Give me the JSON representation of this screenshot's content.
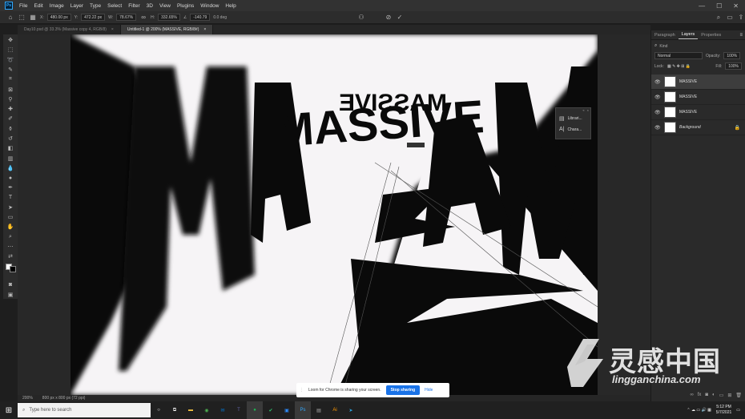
{
  "menubar": {
    "app_icon": "Ps",
    "items": [
      "File",
      "Edit",
      "Image",
      "Layer",
      "Type",
      "Select",
      "Filter",
      "3D",
      "View",
      "Plugins",
      "Window",
      "Help"
    ],
    "window_controls": [
      "—",
      "☐",
      "✕"
    ]
  },
  "options": {
    "x_label": "X:",
    "x_value": "480.00 px",
    "y_label": "Y:",
    "y_value": "472.22 px",
    "w_label": "W:",
    "w_value": "78.67%",
    "h_label": "H:",
    "h_value": "332.65%",
    "angle_label": "∠",
    "angle_value": "-140.79",
    "warp_label": "0.0 deg"
  },
  "tabs": [
    {
      "label": "Day10.psd @ 33.3% (Massive copy 4, RGB/8)",
      "close": "×",
      "active": false
    },
    {
      "label": "Untitled-1 @ 200% (MASSIVE, RGB/8#)",
      "close": "×",
      "active": true
    }
  ],
  "artwork": {
    "text": "MASSIVE"
  },
  "float_panel": {
    "items": [
      "Librari...",
      "Chara..."
    ]
  },
  "panel": {
    "tabs": [
      "Paragraph",
      "Layers",
      "Properties"
    ],
    "search_placeholder": "Kind",
    "blend_mode": "Normal",
    "opacity_label": "Opacity:",
    "opacity_value": "100%",
    "lock_label": "Lock:",
    "fill_label": "Fill:",
    "fill_value": "100%",
    "layers": [
      {
        "name": "MASSIVE",
        "selected": true
      },
      {
        "name": "MASSIVE",
        "selected": false
      },
      {
        "name": "MASSIVE",
        "selected": false
      },
      {
        "name": "Background",
        "selected": false,
        "italic": true
      }
    ]
  },
  "status": {
    "zoom": "200%",
    "doc_size": "800 px x 800 px (72 ppi)"
  },
  "sharebar": {
    "message": "Loom for Chrome is sharing your screen.",
    "stop_label": "Stop sharing",
    "hide_label": "Hide"
  },
  "taskbar": {
    "search_placeholder": "Type here to search",
    "time": "5:12 PM",
    "date": "5/7/2021"
  },
  "watermark": {
    "brand": "灵感中国",
    "url": "lingganchina.com"
  }
}
